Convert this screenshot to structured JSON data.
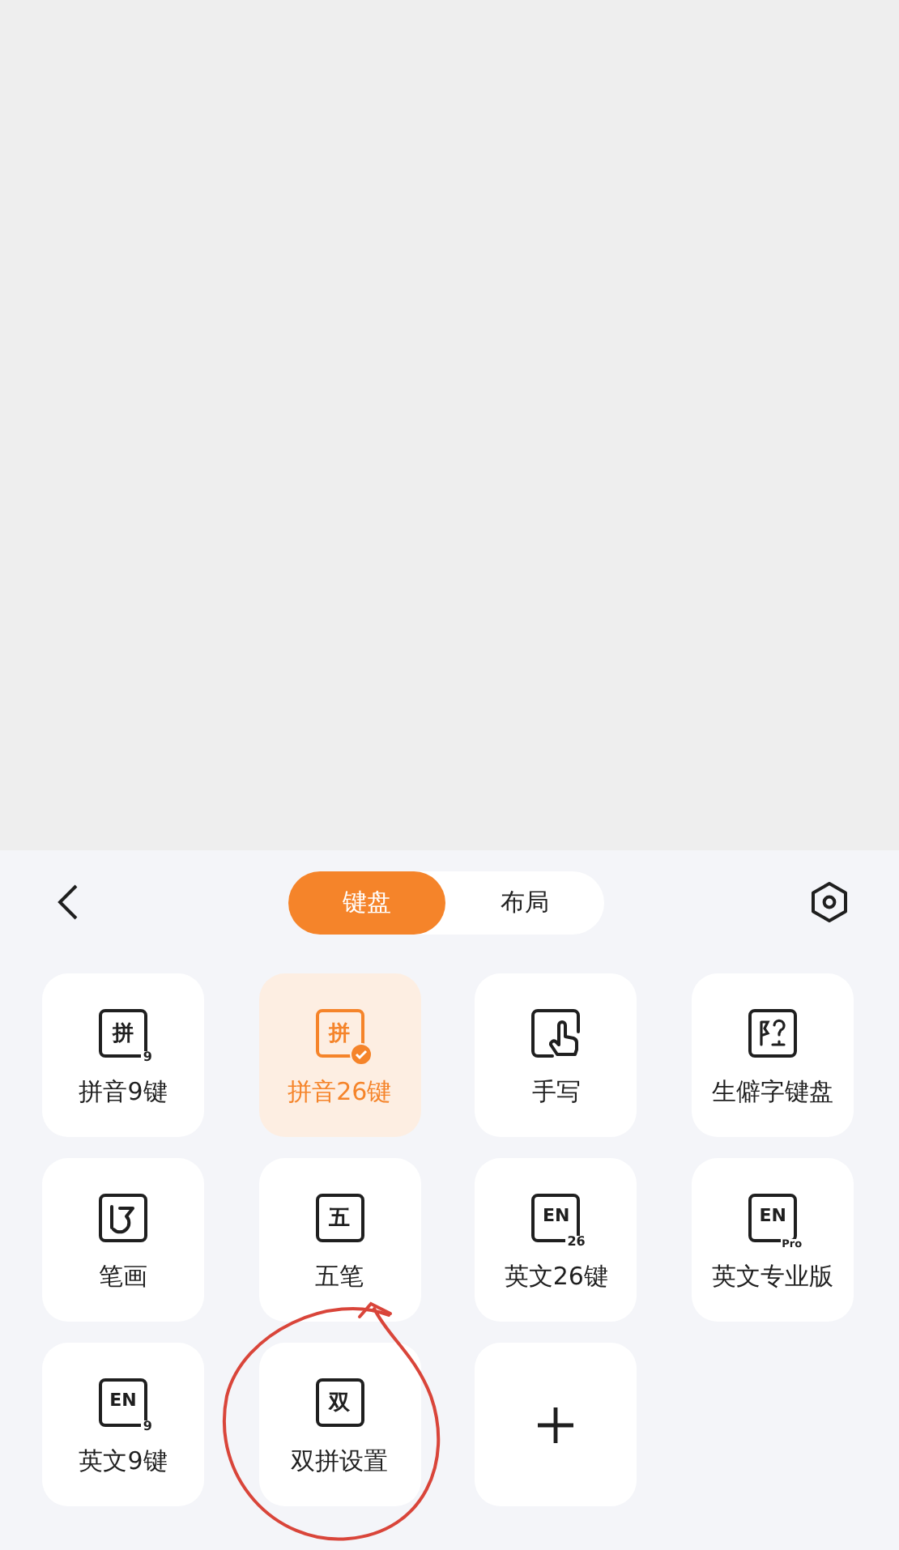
{
  "header": {
    "tabs": [
      {
        "label": "键盘",
        "selected": true
      },
      {
        "label": "布局",
        "selected": false
      }
    ]
  },
  "keyboards": [
    {
      "kind": "glyph",
      "glyph": "拼",
      "sub": "9",
      "label": "拼音9键",
      "selected": false
    },
    {
      "kind": "glyph",
      "glyph": "拼",
      "label": "拼音26键",
      "selected": true
    },
    {
      "kind": "hand",
      "label": "手写",
      "selected": false
    },
    {
      "kind": "rare",
      "label": "生僻字键盘",
      "selected": false
    },
    {
      "kind": "stroke",
      "label": "笔画",
      "selected": false
    },
    {
      "kind": "glyph",
      "glyph": "五",
      "label": "五笔",
      "selected": false
    },
    {
      "kind": "glyph",
      "glyph": "EN",
      "sub": "26",
      "label": "英文26键",
      "selected": false
    },
    {
      "kind": "glyph",
      "glyph": "EN",
      "sub": "Pro",
      "label": "英文专业版",
      "selected": false
    },
    {
      "kind": "glyph",
      "glyph": "EN",
      "sub": "9",
      "label": "英文9键",
      "selected": false
    },
    {
      "kind": "glyph",
      "glyph": "双",
      "label": "双拼设置",
      "selected": false
    },
    {
      "kind": "add",
      "selected": false
    }
  ]
}
